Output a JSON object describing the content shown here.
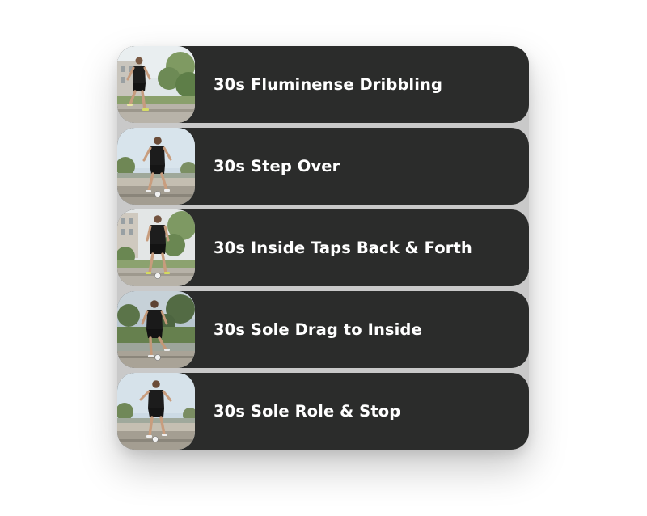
{
  "drills": [
    {
      "label": "30s Fluminense Dribbling",
      "thumbnail": "player-dribbling-photo"
    },
    {
      "label": "30s Step Over",
      "thumbnail": "player-step-over-photo"
    },
    {
      "label": "30s Inside Taps Back & Forth",
      "thumbnail": "player-inside-taps-photo"
    },
    {
      "label": "30s Sole Drag to Inside",
      "thumbnail": "player-sole-drag-photo"
    },
    {
      "label": "30s Sole Role & Stop",
      "thumbnail": "player-sole-roll-photo"
    }
  ],
  "colors": {
    "card_background": "#2b2c2b",
    "label_text": "#ffffff",
    "page_background": "#ffffff"
  }
}
